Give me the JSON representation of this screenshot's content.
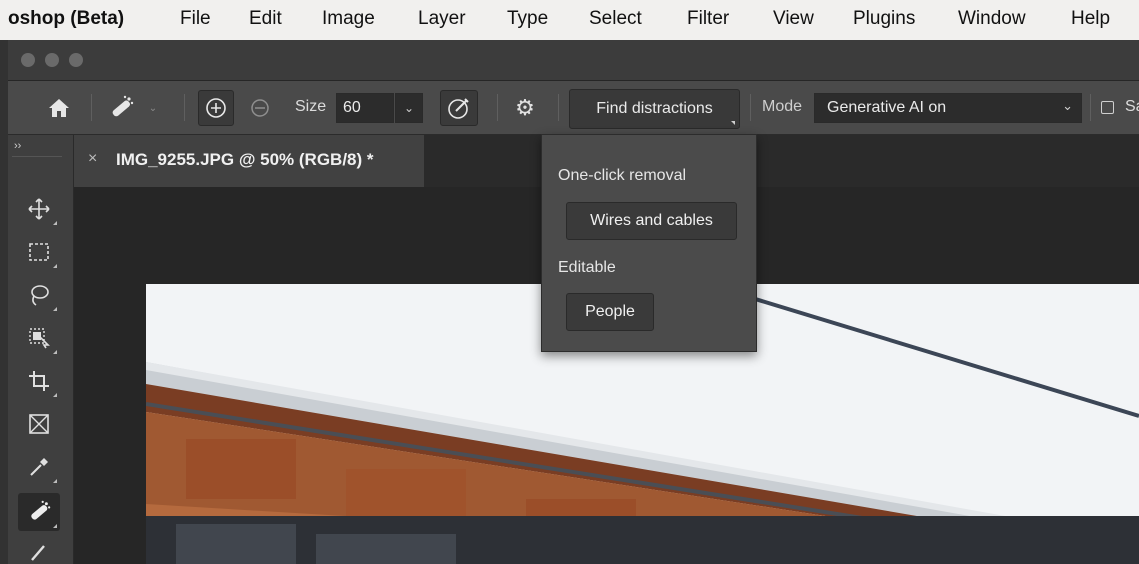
{
  "menubar": {
    "app": "oshop (Beta)",
    "items": [
      "File",
      "Edit",
      "Image",
      "Layer",
      "Type",
      "Select",
      "Filter",
      "View",
      "Plugins",
      "Window",
      "Help"
    ]
  },
  "options": {
    "size_label": "Size",
    "size_value": "60",
    "find_distractions": "Find distractions",
    "mode_label": "Mode",
    "mode_value": "Generative AI on",
    "trailing_label": "Sa"
  },
  "document": {
    "tab_title": "IMG_9255.JPG @ 50% (RGB/8) *",
    "close": "×"
  },
  "dropdown": {
    "section1": "One-click removal",
    "wires_button": "Wires and cables",
    "section2": "Editable",
    "people_button": "People"
  },
  "toolbar": {
    "collapse": "››",
    "tools": [
      "move-tool-icon",
      "marquee-tool-icon",
      "lasso-tool-icon",
      "object-selection-tool-icon",
      "crop-tool-icon",
      "frame-tool-icon",
      "eyedropper-tool-icon",
      "remove-tool-icon",
      "brush-tool-icon"
    ]
  },
  "colors": {
    "accent_panel": "#4b4b4b",
    "canvas_bg": "#262626",
    "menu_bg": "#f1f0ee"
  }
}
